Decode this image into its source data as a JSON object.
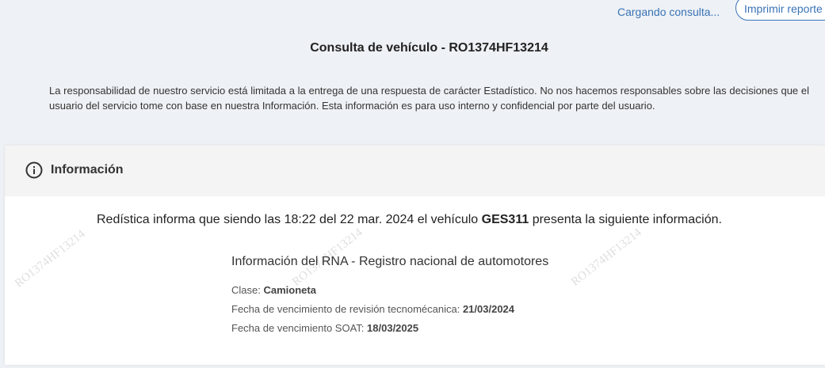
{
  "topbar": {
    "loading_text": "Cargando consulta...",
    "print_label": "Imprimir reporte"
  },
  "page": {
    "title": "Consulta de vehículo - RO1374HF13214",
    "disclaimer": "La responsabilidad de nuestro servicio está limitada a la entrega de una respuesta de carácter Estadístico. No nos hacemos responsables sobre las decisiones que el usuario del servicio tome con base en nuestra Información. Esta información es para uso interno y confidencial por parte del usuario."
  },
  "card": {
    "icon": "info-circle-icon",
    "title": "Información",
    "report": {
      "prefix": "Redística informa que siendo las 18:22 del 22 mar. 2024 el vehículo",
      "plate": "GES311",
      "suffix": "presenta la siguiente información."
    },
    "rna": {
      "title": "Información del RNA - Registro nacional de automotores",
      "rows": [
        {
          "label": "Clase:",
          "value": "Camioneta"
        },
        {
          "label": "Fecha de vencimiento de revisión tecnomécanica:",
          "value": "21/03/2024"
        },
        {
          "label": "Fecha de vencimiento SOAT:",
          "value": "18/03/2025"
        }
      ]
    },
    "watermark": "RO1374HF13214"
  },
  "colors": {
    "accent": "#3a73b6",
    "page_bg": "#eef1f5",
    "card_header_bg": "#f4f4f4"
  }
}
